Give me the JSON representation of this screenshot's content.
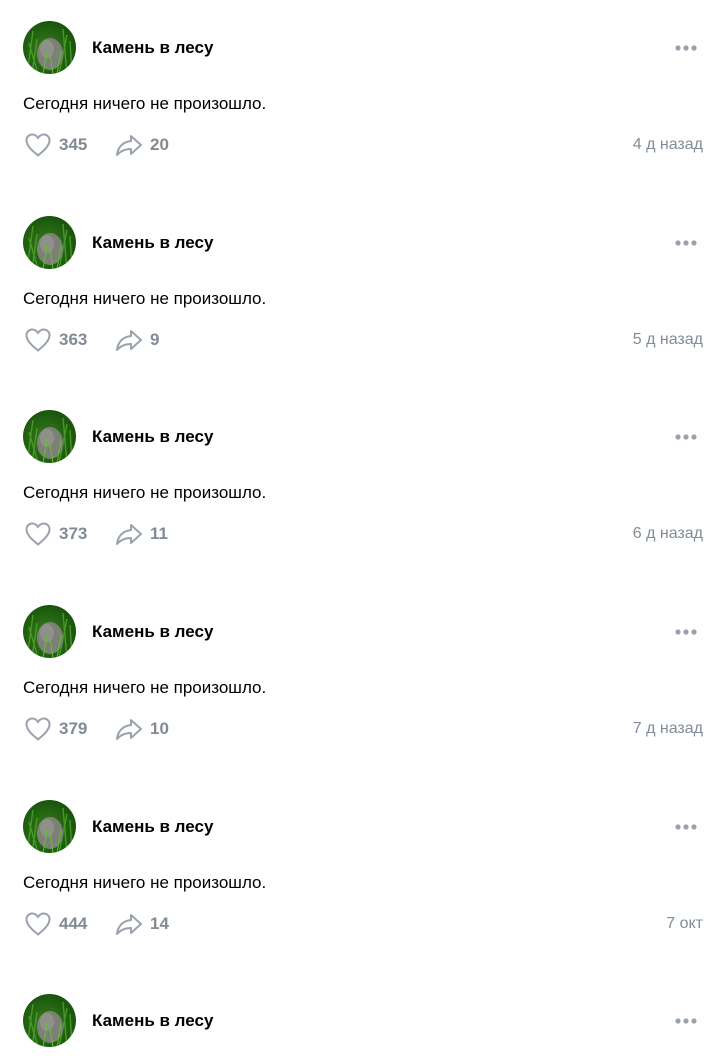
{
  "feed": {
    "posts": [
      {
        "author": "Камень в лесу",
        "text": "Сегодня ничего не произошло.",
        "likes": "345",
        "shares": "20",
        "time": "4 д назад"
      },
      {
        "author": "Камень в лесу",
        "text": "Сегодня ничего не произошло.",
        "likes": "363",
        "shares": "9",
        "time": "5 д назад"
      },
      {
        "author": "Камень в лесу",
        "text": "Сегодня ничего не произошло.",
        "likes": "373",
        "shares": "11",
        "time": "6 д назад"
      },
      {
        "author": "Камень в лесу",
        "text": "Сегодня ничего не произошло.",
        "likes": "379",
        "shares": "10",
        "time": "7 д назад"
      },
      {
        "author": "Камень в лесу",
        "text": "Сегодня ничего не произошло.",
        "likes": "444",
        "shares": "14",
        "time": "7 окт"
      },
      {
        "author": "Камень в лесу"
      }
    ]
  },
  "icons": {
    "like": "heart-outline-icon",
    "share": "share-arrow-icon",
    "more": "more-horizontal-icon",
    "avatar": "stone-in-grass-avatar"
  },
  "colors": {
    "text": "#000000",
    "muted": "#818c99",
    "icon": "#99a2ad",
    "avatar_green": "#2a6e14"
  }
}
